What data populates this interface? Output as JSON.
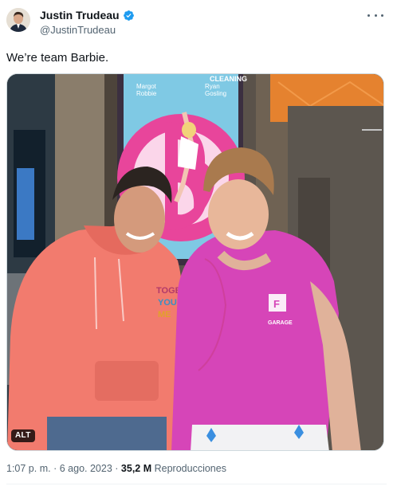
{
  "author": {
    "display_name": "Justin Trudeau",
    "handle": "@JustinTrudeau",
    "verified": true,
    "avatar_icon": "profile-photo"
  },
  "tweet": {
    "text": "We’re team Barbie."
  },
  "media": {
    "alt_badge": "ALT",
    "poster": {
      "top_text": "CLEANING",
      "name_left_1": "Margot",
      "name_left_2": "Robbie",
      "name_right_1": "Ryan",
      "name_right_2": "Gosling"
    },
    "shirt_text": "GARAGE",
    "hoodie_text": "TOGE YOU ME"
  },
  "meta": {
    "time": "1:07 p. m.",
    "separator": "·",
    "date": "6 ago. 2023",
    "views_count": "35,2 M",
    "views_label": "Reproducciones"
  },
  "colors": {
    "text_primary": "#0f1419",
    "text_secondary": "#536471",
    "verified_blue": "#1d9bf0",
    "hoodie_coral": "#f27b6e",
    "shirt_magenta": "#d645b8",
    "barbie_pink": "#e8459b"
  }
}
